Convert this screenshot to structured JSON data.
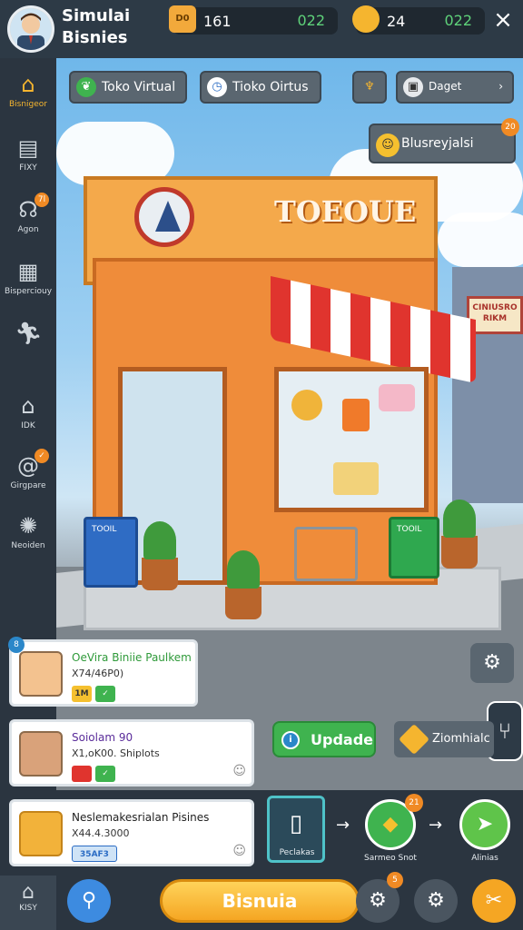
{
  "header": {
    "title": "Simulai Bisnies",
    "resource1": {
      "icon_label": "D0",
      "value": "161",
      "sub": "022"
    },
    "resource2": {
      "value": "24",
      "sub": "022"
    },
    "close_icon": "×"
  },
  "sidebar": {
    "items": [
      {
        "label": "Bisnigeor",
        "icon": "home-icon",
        "badge": ""
      },
      {
        "label": "FIXY",
        "icon": "trash-icon",
        "badge": ""
      },
      {
        "label": "Agon",
        "icon": "agent-icon",
        "badge": "7l"
      },
      {
        "label": "Bisperciouy",
        "icon": "chart-icon",
        "badge": ""
      },
      {
        "label": "",
        "icon": "runner-icon",
        "badge": ""
      },
      {
        "label": "IDK",
        "icon": "house-icon",
        "badge": ""
      },
      {
        "label": "Girgpare",
        "icon": "spiral-icon",
        "badge": ""
      },
      {
        "label": "Neoiden",
        "icon": "lightbulb-icon",
        "badge": ""
      }
    ]
  },
  "scene": {
    "buttons": {
      "toko_virtual": "Toko Virtual",
      "toko_oirtus": "Tioko Oirtus",
      "daget": "Daget",
      "blusreyjalsi": "Blusreyjalsi",
      "blusreyjalsi_badge": "20"
    },
    "shop_sign": "TOEOUE",
    "background_sign": "CINIUSRO RIKM",
    "bin_blue_label": "TOOIL",
    "bin_green_label": "TOOIL"
  },
  "cards": [
    {
      "title": "OeVira Biniie Paulkem",
      "sub": "X74/46P0)",
      "badge": "8",
      "chip1": "1M",
      "chip2": "✓",
      "title_color": "#2f9a3a"
    },
    {
      "title": "Soiolam 90",
      "sub": "X1,oK00. Shiplots",
      "badge": "",
      "chip1": "",
      "chip2": "✓",
      "title_color": "#5a2c9a"
    },
    {
      "title": "Neslemakesrialan Pisines",
      "sub": "X44.4.3000",
      "badge": "",
      "chip1": "35AF3",
      "chip2": "",
      "title_color": "#222"
    }
  ],
  "actions": {
    "update": "Updade",
    "zoom": "Ziomhialc"
  },
  "flow": {
    "node1": "Peclakas",
    "node2": "Sarmeo Snot",
    "node2_badge": "21",
    "node3": "Alinias"
  },
  "bottom_nav": {
    "home_label": "KISY",
    "main_action": "Bisnuia",
    "badge": "5"
  }
}
